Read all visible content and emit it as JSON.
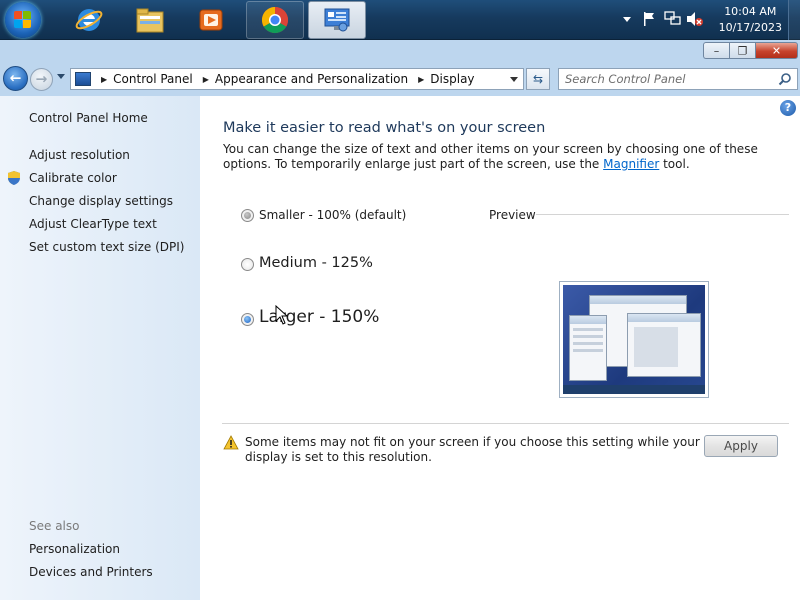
{
  "taskbar": {
    "apps": [
      {
        "name": "Internet Explorer",
        "icon": "ie-icon"
      },
      {
        "name": "Windows Explorer",
        "icon": "folder-icon"
      },
      {
        "name": "Windows Media Player",
        "icon": "media-player-icon"
      },
      {
        "name": "Google Chrome",
        "icon": "chrome-icon"
      },
      {
        "name": "Control Panel",
        "icon": "control-panel-icon"
      }
    ],
    "clock": {
      "time": "10:04 AM",
      "date": "10/17/2023"
    }
  },
  "window": {
    "caption": {
      "minimize": "–",
      "maximize": "❐",
      "close": "✕"
    },
    "address": {
      "crumbs": [
        "Control Panel",
        "Appearance and Personalization",
        "Display"
      ]
    },
    "search": {
      "placeholder": "Search Control Panel"
    }
  },
  "sidebar": {
    "home": "Control Panel Home",
    "links": [
      "Adjust resolution",
      "Calibrate color",
      "Change display settings",
      "Adjust ClearType text",
      "Set custom text size (DPI)"
    ],
    "see_also_title": "See also",
    "see_also": [
      "Personalization",
      "Devices and Printers"
    ]
  },
  "main": {
    "help": "?",
    "heading": "Make it easier to read what's on your screen",
    "description_before": "You can change the size of text and other items on your screen by choosing one of these options. To temporarily enlarge just part of the screen, use the ",
    "magnifier_link": "Magnifier",
    "description_after": " tool.",
    "options": [
      {
        "label": "Smaller - 100% (default)",
        "selected": false
      },
      {
        "label": "Medium - 125%",
        "selected": false
      },
      {
        "label": "Larger - 150%",
        "selected": true
      }
    ],
    "preview_label": "Preview",
    "warning": "Some items may not fit on your screen if you choose this setting while your display is set to this resolution.",
    "apply_label": "Apply"
  },
  "colors": {
    "heading": "#1e395b",
    "link": "#0066cc",
    "sidebar_bg": "#dae8f6",
    "taskbar": "#163a5e"
  }
}
